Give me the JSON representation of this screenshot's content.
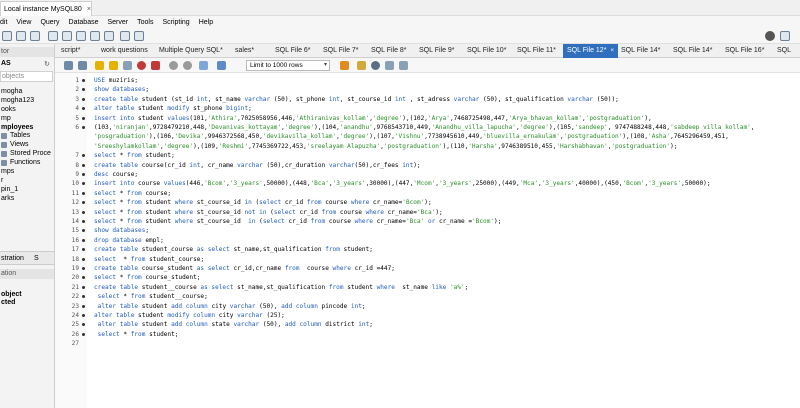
{
  "window": {
    "instance_tab": "Local instance MySQL80",
    "close_glyph": "×"
  },
  "menu": {
    "items": [
      "dit",
      "View",
      "Query",
      "Database",
      "Server",
      "Tools",
      "Scripting",
      "Help"
    ]
  },
  "sidebar": {
    "header_top": "tor",
    "header_schemas": "AS",
    "search_placeholder": "objects",
    "schemas": [
      "mogha",
      "mogha123",
      "ooks",
      "mp"
    ],
    "selected_schema": "mployees",
    "sub_items": [
      "Tables",
      "Views",
      "Stored Proce",
      "Functions"
    ],
    "more_schemas": [
      "mps",
      "r",
      "pin_1",
      "arks"
    ],
    "bottom_tab": "stration",
    "bottom_tab2": "S",
    "info_header": "ation",
    "info_text_1": "object",
    "info_text_2": "cted"
  },
  "tabs": [
    {
      "label": "script*"
    },
    {
      "label": "work questions"
    },
    {
      "label": "Multiple Query SQL*"
    },
    {
      "label": "sales*"
    },
    {
      "label": "SQL File 6*"
    },
    {
      "label": "SQL File 7*"
    },
    {
      "label": "SQL File 8*"
    },
    {
      "label": "SQL File 9*"
    },
    {
      "label": "SQL File 10*"
    },
    {
      "label": "SQL File 11*"
    },
    {
      "label": "SQL File 12*",
      "active": true
    },
    {
      "label": "SQL File 14*"
    },
    {
      "label": "SQL File 14*"
    },
    {
      "label": "SQL File 16*"
    },
    {
      "label": "SQL"
    }
  ],
  "editor_toolbar": {
    "limit_label": "Limit to 1000 rows"
  },
  "editor": {
    "lines": [
      {
        "n": "1",
        "text": "USE muziris;"
      },
      {
        "n": "2",
        "text": "show databases;"
      },
      {
        "n": "3",
        "text": "create table student (st_id int, st_name varchar (50), st_phone int, st_course_id int , st_adress varchar (50), st_qualification varchar (50));"
      },
      {
        "n": "4",
        "text": "alter table student modify st_phone bigint;"
      },
      {
        "n": "5",
        "text": "insert into student values(101,'Athira',7025058956,446,'Athiranivas_kollam','degree'),(102,'Arya',7468725498,447,'Arya_bhavan_kollam','postgraduation'),"
      },
      {
        "n": "6",
        "text": "(103,'niranjan',9728479210,448,'Devanivas_kottayam','degree'),(104,'anandhu',9768543710,449,'Anandhu_villa_lapucha','degree'),(105,'sandeep', 9747488248,448,'sabdeep villa kollam',"
      },
      {
        "n": "",
        "text": "'posgraduation'),(106,'Devika',9946372568,450,'devikavilla_kollam','degree'),(107,'Vishnu',7738945610,449,'bluevilla_ernakulam','postgraduation'),(108,'Asha',7645296459,451,"
      },
      {
        "n": "",
        "text": "'Sreeshylamkollam','degree'),(109,'Reshmi',7745369722,453,'sreelayam Alapuzha','postgraduation'),(110,'Harsha',9746389510,455,'Harshabhavan','postgraduation');"
      },
      {
        "n": "7",
        "text": "select * from student;"
      },
      {
        "n": "8",
        "text": "create table course(cr_id int, cr_name varchar (50),cr_duration varchar(50),cr_fees int);"
      },
      {
        "n": "9",
        "text": "desc course;"
      },
      {
        "n": "10",
        "text": "insert into course values(446,'Bcom','3_years',50000),(448,'Bca','3_years',30000),(447,'Mcom','3_years',25000),(449,'Mca','3_years',40000),(450,'Bcom','3_years',50000);"
      },
      {
        "n": "11",
        "text": "select * from course;"
      },
      {
        "n": "12",
        "text": "select * from student where st_course_id in (select cr_id from course where cr_name='Bcom');"
      },
      {
        "n": "13",
        "text": "select * from student where st_course_id not in (select cr_id from course where cr_name='Bca');"
      },
      {
        "n": "14",
        "text": "select * from student where st_course_id  in (select cr_id from course where cr_name='Bca' or cr_name ='Bcom');"
      },
      {
        "n": "15",
        "text": "show databases;"
      },
      {
        "n": "16",
        "text": "drop database empl;"
      },
      {
        "n": "17",
        "text": "create table student_course as select st_name,st_qualification from student;"
      },
      {
        "n": "18",
        "text": "select  * from student_course;"
      },
      {
        "n": "19",
        "text": "create table course_student as select cr_id,cr_name from  course where cr_id =447;"
      },
      {
        "n": "20",
        "text": "select * from course_student;"
      },
      {
        "n": "21",
        "text": "create table student__course as select st_name,st_qualification from student where  st_name like 'a%';"
      },
      {
        "n": "22",
        "text": " select * from student__course;"
      },
      {
        "n": "23",
        "text": " alter table student add column city varchar (50), add column pincode int;"
      },
      {
        "n": "24",
        "text": "alter table student modify column city varchar (25);"
      },
      {
        "n": "25",
        "text": " alter table student add column state varchar (50), add column district int;"
      },
      {
        "n": "26",
        "text": " select * from student;"
      },
      {
        "n": "27",
        "text": ""
      }
    ]
  },
  "colors": {
    "keyword": "#1f5bbf",
    "string": "#2a8f2a",
    "active_tab": "#2f6fbd"
  }
}
